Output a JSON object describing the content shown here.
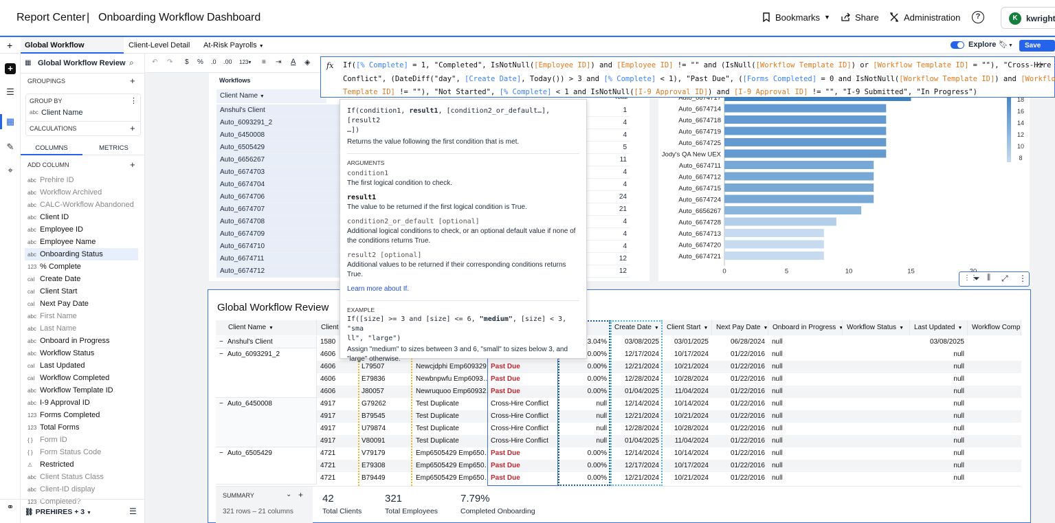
{
  "header": {
    "app_title": "Report Center",
    "separator": "|",
    "page_title": "Onboarding Workflow Dashboard",
    "bookmarks": "Bookmarks",
    "share": "Share",
    "administration": "Administration",
    "user_initial": "K",
    "user_name": "kwright"
  },
  "tabs": {
    "add": "+",
    "items": [
      "Global Workflow Overview",
      "Client-Level Detail",
      "At-Risk Payrolls"
    ],
    "explore": "Explore",
    "save_as": "Save as"
  },
  "left_panel": {
    "title": "Global Workflow Review",
    "groupings": "GROUPINGS",
    "group_by": "GROUP BY",
    "group_field": "Client Name",
    "calculations": "CALCULATIONS",
    "tab_columns": "COLUMNS",
    "tab_metrics": "METRICS",
    "add_column": "ADD COLUMN",
    "columns": [
      {
        "type": "abc",
        "label": "Prehire ID",
        "muted": true
      },
      {
        "type": "abc",
        "label": "Workflow Archived",
        "muted": true
      },
      {
        "type": "abc",
        "label": "CALC-Workflow Abandoned",
        "muted": true
      },
      {
        "type": "abc",
        "label": "Client ID",
        "muted": false
      },
      {
        "type": "abc",
        "label": "Employee ID",
        "muted": false
      },
      {
        "type": "abc",
        "label": "Employee Name",
        "muted": false
      },
      {
        "type": "abc",
        "label": "Onboarding Status",
        "muted": false
      },
      {
        "type": "123",
        "label": "% Complete",
        "muted": false
      },
      {
        "type": "cal",
        "label": "Create Date",
        "muted": false
      },
      {
        "type": "cal",
        "label": "Client Start",
        "muted": false
      },
      {
        "type": "cal",
        "label": "Next Pay Date",
        "muted": false
      },
      {
        "type": "abc",
        "label": "First Name",
        "muted": true
      },
      {
        "type": "abc",
        "label": "Last Name",
        "muted": true
      },
      {
        "type": "abc",
        "label": "Onboard in Progress",
        "muted": false
      },
      {
        "type": "abc",
        "label": "Workflow Status",
        "muted": false
      },
      {
        "type": "cal",
        "label": "Last Updated",
        "muted": false
      },
      {
        "type": "cal",
        "label": "Workflow Completed",
        "muted": false
      },
      {
        "type": "abc",
        "label": "Workflow Template ID",
        "muted": false
      },
      {
        "type": "abc",
        "label": "I-9 Approval ID",
        "muted": false
      },
      {
        "type": "123",
        "label": "Forms Completed",
        "muted": false
      },
      {
        "type": "123",
        "label": "Total Forms",
        "muted": false
      },
      {
        "type": "{ }",
        "label": "Form ID",
        "muted": true
      },
      {
        "type": "{ }",
        "label": "Form Status Code",
        "muted": true
      },
      {
        "type": "⚠",
        "label": "Restricted",
        "muted": false
      },
      {
        "type": "abc",
        "label": "Client Status Class",
        "muted": true
      },
      {
        "type": "abc",
        "label": "Client-ID display",
        "muted": true
      },
      {
        "type": "123",
        "label": "Completed?",
        "muted": true
      }
    ],
    "footer": "PREHIRES + 3"
  },
  "formula": {
    "fx": "fx",
    "line1": [
      {
        "t": "If(",
        "c": ""
      },
      {
        "t": "[% Complete]",
        "c": "fb"
      },
      {
        "t": " = 1, \"Completed\", IsNotNull(",
        "c": ""
      },
      {
        "t": "[Employee ID]",
        "c": "fr"
      },
      {
        "t": ") and ",
        "c": ""
      },
      {
        "t": "[Employee ID]",
        "c": "fr"
      },
      {
        "t": " != \"\" and (IsNull(",
        "c": ""
      },
      {
        "t": "[Workflow Template ID]",
        "c": "fr"
      },
      {
        "t": ") or ",
        "c": ""
      },
      {
        "t": "[Workflow Template ID]",
        "c": "fr"
      },
      {
        "t": " = \"\"), \"Cross-Hire",
        "c": ""
      }
    ],
    "line2": [
      {
        "t": "Conflict\", (DateDiff(\"day\", ",
        "c": ""
      },
      {
        "t": "[Create Date]",
        "c": "fb"
      },
      {
        "t": ", Today()) > 3 and ",
        "c": ""
      },
      {
        "t": "[% Complete]",
        "c": "fb"
      },
      {
        "t": " < 1), \"Past Due\", (",
        "c": ""
      },
      {
        "t": "[Forms Completed]",
        "c": "fb"
      },
      {
        "t": " = 0 and IsNotNull(",
        "c": ""
      },
      {
        "t": "[Workflow Template ID]",
        "c": "fr"
      },
      {
        "t": ") and ",
        "c": ""
      },
      {
        "t": "[Workflow",
        "c": "fr"
      }
    ],
    "line3": [
      {
        "t": "Template ID]",
        "c": "fr"
      },
      {
        "t": " != \"\"), \"Not Started\", ",
        "c": ""
      },
      {
        "t": "[% Complete]",
        "c": "fb"
      },
      {
        "t": " < 1 and IsNotNull(",
        "c": ""
      },
      {
        "t": "[I-9 Approval ID]",
        "c": "fr"
      },
      {
        "t": ") and ",
        "c": ""
      },
      {
        "t": "[I-9 Approval ID]",
        "c": "fr"
      },
      {
        "t": " != \"\", \"I-9 Submitted\", \"In Progress\")",
        "c": ""
      }
    ]
  },
  "tooltip": {
    "signature_1": "If(condition1, ",
    "signature_b": "result1",
    "signature_2": ", [condition2_or_default…], [result2",
    "signature_3": "…])",
    "desc": "Returns the value following the first condition that is met.",
    "args_title": "ARGUMENTS",
    "args": [
      {
        "name": "condition1",
        "bold": false,
        "desc": "The first logical condition to check."
      },
      {
        "name": "result1",
        "bold": true,
        "desc": "The value to be returned if the first logical condition is True."
      },
      {
        "name": "condition2_or_default [optional]",
        "bold": false,
        "desc": "Additional logical conditions to check, or an optional default value if none of the conditions returns True."
      },
      {
        "name": "result2 [optional]",
        "bold": false,
        "desc": "Additional values to be returned if their corresponding conditions returns True."
      }
    ],
    "learn_more": "Learn more about If.",
    "example_title": "EXAMPLE",
    "example_1": "If([size] >= 3 and [size] <= 6, ",
    "example_b": "\"medium\"",
    "example_2": ", [size] < 3, \"sma",
    "example_3": "ll\", \"large\")",
    "example_desc": "Assign \"medium\" to sizes between 3 and 6, \"small\" to sizes below 3, and \"large\" otherwise."
  },
  "workflows_card": {
    "title": "Workflows",
    "col_client": "Client Name",
    "col_total": "Total",
    "rows": [
      {
        "name": "Anshul's Client",
        "val": "1"
      },
      {
        "name": "Auto_6093291_2",
        "val": "4"
      },
      {
        "name": "Auto_6450008",
        "val": "4"
      },
      {
        "name": "Auto_6505429",
        "val": "5"
      },
      {
        "name": "Auto_6656267",
        "val": "11"
      },
      {
        "name": "Auto_6674703",
        "val": "4"
      },
      {
        "name": "Auto_6674704",
        "val": "4"
      },
      {
        "name": "Auto_6674706",
        "val": "24"
      },
      {
        "name": "Auto_6674707",
        "val": "21"
      },
      {
        "name": "Auto_6674708",
        "val": "4"
      },
      {
        "name": "Auto_6674709",
        "val": "4"
      },
      {
        "name": "Auto_6674710",
        "val": "4"
      },
      {
        "name": "Auto_6674711",
        "val": "12"
      },
      {
        "name": "Auto_6674712",
        "val": "12"
      }
    ]
  },
  "bar_chart": {
    "categories": [
      "Auto_6674717",
      "Auto_6674714",
      "Auto_6674718",
      "Auto_6674719",
      "Auto_6674725",
      "Jody's QA New UEX",
      "Auto_6674711",
      "Auto_6674712",
      "Auto_6674715",
      "Auto_6674724",
      "Auto_6656267",
      "Auto_6674728",
      "Auto_6674713",
      "Auto_6674720",
      "Auto_6674721"
    ],
    "values": [
      15,
      13,
      13,
      13,
      13,
      13,
      12,
      12,
      12,
      12,
      11,
      9,
      8,
      8,
      8
    ],
    "xlim": [
      0,
      20
    ],
    "xticks": [
      "0",
      "5",
      "10",
      "15",
      "20"
    ],
    "legend_ticks": [
      "18",
      "16",
      "14",
      "12",
      "10",
      "8"
    ],
    "color_high": "#3b82c4",
    "color_low": "#c6dbef"
  },
  "review_table": {
    "title": "Global Workflow Review",
    "headers": [
      "Client Name",
      "Client I",
      "",
      "",
      "",
      "lete",
      "Create Date",
      "Client Start",
      "Next Pay Date",
      "Onboard in Progress",
      "Workflow Status",
      "Last Updated",
      "Workflow Comple"
    ],
    "groups": [
      {
        "name": "Anshul's Client",
        "rows": [
          {
            "cid": "1580",
            "emp": "",
            "ename": "",
            "status": "",
            "red": false,
            "pct": "13.04%",
            "create": "03/08/2025",
            "start": "03/01/2025",
            "pay": "06/28/2024",
            "onb": "null",
            "wf": "",
            "upd": "03/08/2025"
          }
        ]
      },
      {
        "name": "Auto_6093291_2",
        "rows": [
          {
            "cid": "4606",
            "emp": "",
            "ename": "",
            "status": "",
            "red": false,
            "pct": "0.00%",
            "create": "12/17/2024",
            "start": "10/17/2024",
            "pay": "01/22/2016",
            "onb": "null",
            "wf": "",
            "upd": "null"
          },
          {
            "cid": "4606",
            "emp": "L79507",
            "ename": "Newcjdphi Emp609329…",
            "status": "Past Due",
            "red": true,
            "pct": "0.00%",
            "create": "12/21/2024",
            "start": "10/21/2024",
            "pay": "01/22/2016",
            "onb": "null",
            "wf": "",
            "upd": "null"
          },
          {
            "cid": "4606",
            "emp": "E79836",
            "ename": "Newbnpwfu Emp6093…",
            "status": "Past Due",
            "red": true,
            "pct": "0.00%",
            "create": "12/28/2024",
            "start": "10/28/2024",
            "pay": "01/22/2016",
            "onb": "null",
            "wf": "",
            "upd": "null"
          },
          {
            "cid": "4606",
            "emp": "J80057",
            "ename": "Newruquoo Emp60932…",
            "status": "Past Due",
            "red": true,
            "pct": "0.00%",
            "create": "01/04/2025",
            "start": "11/04/2024",
            "pay": "01/22/2016",
            "onb": "null",
            "wf": "",
            "upd": "null"
          }
        ]
      },
      {
        "name": "Auto_6450008",
        "rows": [
          {
            "cid": "4917",
            "emp": "G79262",
            "ename": "Test Duplicate",
            "status": "Cross-Hire Conflict",
            "red": false,
            "pct": "null",
            "create": "12/14/2024",
            "start": "10/14/2024",
            "pay": "01/22/2016",
            "onb": "null",
            "wf": "",
            "upd": "null"
          },
          {
            "cid": "4917",
            "emp": "B79545",
            "ename": "Test Duplicate",
            "status": "Cross-Hire Conflict",
            "red": false,
            "pct": "null",
            "create": "12/21/2024",
            "start": "10/21/2024",
            "pay": "01/22/2016",
            "onb": "null",
            "wf": "",
            "upd": "null"
          },
          {
            "cid": "4917",
            "emp": "U79874",
            "ename": "Test Duplicate",
            "status": "Cross-Hire Conflict",
            "red": false,
            "pct": "null",
            "create": "12/28/2024",
            "start": "10/28/2024",
            "pay": "01/22/2016",
            "onb": "null",
            "wf": "",
            "upd": "null"
          },
          {
            "cid": "4917",
            "emp": "V80091",
            "ename": "Test Duplicate",
            "status": "Cross-Hire Conflict",
            "red": false,
            "pct": "null",
            "create": "01/04/2025",
            "start": "11/04/2024",
            "pay": "01/22/2016",
            "onb": "null",
            "wf": "",
            "upd": "null"
          }
        ]
      },
      {
        "name": "Auto_6505429",
        "rows": [
          {
            "cid": "4721",
            "emp": "V79179",
            "ename": "Emp6505429 Emp650…",
            "status": "Past Due",
            "red": true,
            "pct": "0.00%",
            "create": "12/14/2024",
            "start": "10/14/2024",
            "pay": "01/22/2016",
            "onb": "null",
            "wf": "",
            "upd": "null"
          },
          {
            "cid": "4721",
            "emp": "E79308",
            "ename": "Emp6505429 Emp650…",
            "status": "Past Due",
            "red": true,
            "pct": "0.00%",
            "create": "12/17/2024",
            "start": "10/17/2024",
            "pay": "01/22/2016",
            "onb": "null",
            "wf": "",
            "upd": "null"
          },
          {
            "cid": "4721",
            "emp": "B79449",
            "ename": "Emp6505429 Emp650…",
            "status": "Past Due",
            "red": true,
            "pct": "0.00%",
            "create": "12/21/2024",
            "start": "10/21/2024",
            "pay": "01/22/2016",
            "onb": "null",
            "wf": "",
            "upd": "null"
          }
        ]
      }
    ],
    "summary_label": "SUMMARY",
    "summary_meta": "321 rows – 21 columns",
    "metrics": [
      {
        "value": "42",
        "label": "Total Clients"
      },
      {
        "value": "321",
        "label": "Total Employees"
      },
      {
        "value": "7.79%",
        "label": "Completed Onboarding"
      }
    ]
  }
}
